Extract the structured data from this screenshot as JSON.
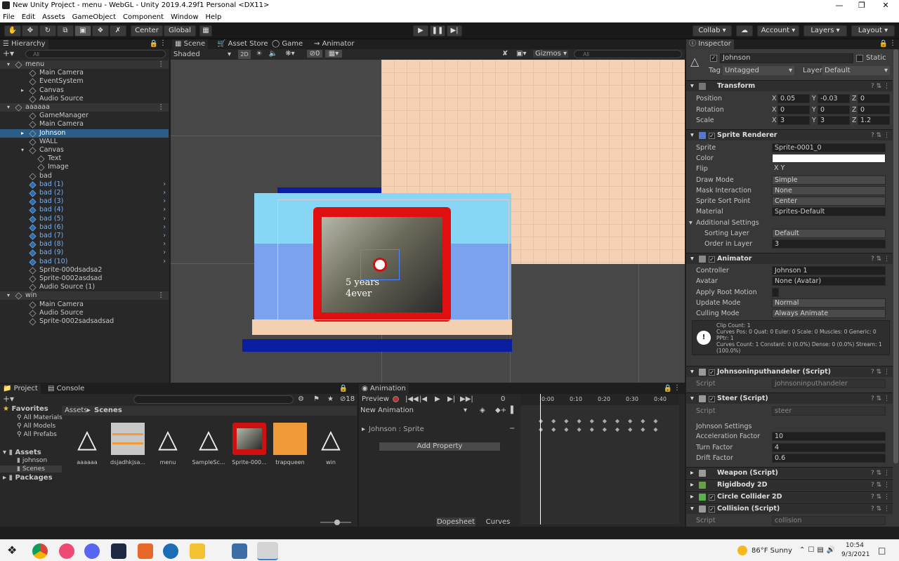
{
  "window": {
    "title": "New Unity Project - menu - WebGL - Unity 2019.4.29f1 Personal <DX11>"
  },
  "menu": [
    "File",
    "Edit",
    "Assets",
    "GameObject",
    "Component",
    "Window",
    "Help"
  ],
  "toolbar": {
    "center": "Center",
    "global": "Global",
    "collab": "Collab",
    "account": "Account",
    "layers": "Layers",
    "layout": "Layout"
  },
  "hierarchy": {
    "tab": "Hierarchy",
    "search_placeholder": "All",
    "rows": [
      {
        "text": "menu",
        "type": "scene"
      },
      {
        "text": "Main Camera",
        "indent": 3
      },
      {
        "text": "EventSystem",
        "indent": 3
      },
      {
        "text": "Canvas",
        "indent": 3
      },
      {
        "text": "Audio Source",
        "indent": 3
      },
      {
        "text": "aaaaaa",
        "type": "scene"
      },
      {
        "text": "GameManager",
        "indent": 3
      },
      {
        "text": "Main Camera",
        "indent": 3
      },
      {
        "text": "Johnson",
        "indent": 3,
        "type": "sel"
      },
      {
        "text": "WALL",
        "indent": 3
      },
      {
        "text": "Canvas",
        "indent": 3
      },
      {
        "text": "Text",
        "indent": 4
      },
      {
        "text": "Image",
        "indent": 4
      },
      {
        "text": "bad",
        "indent": 3
      },
      {
        "text": "bad (1)",
        "indent": 3,
        "type": "blue"
      },
      {
        "text": "bad (2)",
        "indent": 3,
        "type": "blue"
      },
      {
        "text": "bad (3)",
        "indent": 3,
        "type": "blue"
      },
      {
        "text": "bad (4)",
        "indent": 3,
        "type": "blue"
      },
      {
        "text": "bad (5)",
        "indent": 3,
        "type": "blue"
      },
      {
        "text": "bad (6)",
        "indent": 3,
        "type": "blue"
      },
      {
        "text": "bad (7)",
        "indent": 3,
        "type": "blue"
      },
      {
        "text": "bad (8)",
        "indent": 3,
        "type": "blue"
      },
      {
        "text": "bad (9)",
        "indent": 3,
        "type": "blue"
      },
      {
        "text": "bad (10)",
        "indent": 3,
        "type": "blue"
      },
      {
        "text": "Sprite-000dsadsa2",
        "indent": 3
      },
      {
        "text": "Sprite-0002asdsad",
        "indent": 3
      },
      {
        "text": "Audio Source (1)",
        "indent": 3
      },
      {
        "text": "win",
        "type": "scene"
      },
      {
        "text": "Main Camera",
        "indent": 3
      },
      {
        "text": "Audio Source",
        "indent": 3
      },
      {
        "text": "Sprite-0002sadsadsad",
        "indent": 3
      }
    ]
  },
  "scene": {
    "tabs": [
      "Scene",
      "Asset Store",
      "Game",
      "Animator"
    ],
    "shading": "Shaded",
    "mode2d": "2D",
    "gizmos": "Gizmos",
    "search_placeholder": "All",
    "hidden_count": "0",
    "photo_text": "5 years 4ever"
  },
  "inspector": {
    "tab": "Inspector",
    "object_name": "Johnson",
    "static": "Static",
    "tag_label": "Tag",
    "tag": "Untagged",
    "layer_label": "Layer",
    "layer": "Default",
    "transform": {
      "title": "Transform",
      "position": {
        "label": "Position",
        "x": "0.05",
        "y": "-0.03",
        "z": "0"
      },
      "rotation": {
        "label": "Rotation",
        "x": "0",
        "y": "0",
        "z": "0"
      },
      "scale": {
        "label": "Scale",
        "x": "3",
        "y": "3",
        "z": "1.2"
      }
    },
    "sprite_renderer": {
      "title": "Sprite Renderer",
      "rows": [
        {
          "label": "Sprite",
          "value": "Sprite-0001_0"
        },
        {
          "label": "Color",
          "value": ""
        },
        {
          "label": "Flip",
          "value": "X  Y"
        },
        {
          "label": "Draw Mode",
          "value": "Simple"
        },
        {
          "label": "Mask Interaction",
          "value": "None"
        },
        {
          "label": "Sprite Sort Point",
          "value": "Center"
        },
        {
          "label": "Material",
          "value": "Sprites-Default"
        }
      ],
      "additional": "Additional Settings",
      "sorting_layer": {
        "label": "Sorting Layer",
        "value": "Default"
      },
      "order_in_layer": {
        "label": "Order in Layer",
        "value": "3"
      }
    },
    "animator": {
      "title": "Animator",
      "rows": [
        {
          "label": "Controller",
          "value": "Johnson 1"
        },
        {
          "label": "Avatar",
          "value": "None (Avatar)"
        },
        {
          "label": "Apply Root Motion",
          "value": ""
        },
        {
          "label": "Update Mode",
          "value": "Normal"
        },
        {
          "label": "Culling Mode",
          "value": "Always Animate"
        }
      ],
      "info": "Clip Count: 1\nCurves Pos: 0 Quat: 0 Euler: 0 Scale: 0 Muscles: 0 Generic: 0 PPtr: 1\nCurves Count: 1 Constant: 0 (0.0%) Dense: 0 (0.0%) Stream: 1 (100.0%)"
    },
    "scripts": [
      {
        "title": "Johnsoninputhandeler (Script)",
        "script_label": "Script",
        "script": "johnsoninputhandeler"
      },
      {
        "title": "Steer (Script)",
        "script_label": "Script",
        "script": "steer"
      }
    ],
    "johnson_settings": {
      "title": "Johnson Settings",
      "rows": [
        {
          "label": "Acceleration Factor",
          "value": "10"
        },
        {
          "label": "Turn Factor",
          "value": "4"
        },
        {
          "label": "Drift Factor",
          "value": "0.6"
        }
      ]
    },
    "more_components": [
      "Weapon (Script)",
      "Rigidbody 2D",
      "Circle Collider 2D",
      "Collision (Script)"
    ],
    "last_script_label": "Script",
    "last_script": "collision"
  },
  "project": {
    "tabs": [
      "Project",
      "Console"
    ],
    "count": "18",
    "favorites": "Favorites",
    "fav_items": [
      "All Materials",
      "All Models",
      "All Prefabs"
    ],
    "assets": "Assets",
    "asset_folders": [
      "johnson",
      "Scenes"
    ],
    "packages": "Packages",
    "breadcrumb": [
      "Assets",
      "Scenes"
    ],
    "items": [
      "aaaaaa",
      "dsjadhkjsa...",
      "menu",
      "SampleSc...",
      "Sprite-000...",
      "trapqueen",
      "win"
    ]
  },
  "animation": {
    "tab": "Animation",
    "preview": "Preview",
    "frame": "0",
    "clip": "New Animation",
    "property": "Johnson : Sprite",
    "add_property": "Add Property",
    "timeline": [
      "0:00",
      "0:10",
      "0:20",
      "0:30",
      "0:40"
    ],
    "dopesheet": "Dopesheet",
    "curves": "Curves"
  },
  "taskbar": {
    "weather": "86°F  Sunny",
    "time": "10:54",
    "date": "9/3/2021"
  }
}
